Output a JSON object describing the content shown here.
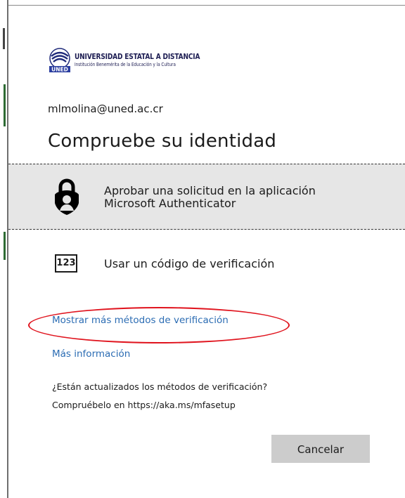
{
  "logo": {
    "title": "UNIVERSIDAD ESTATAL A DISTANCIA",
    "subtitle": "Institución Benemérita de la Educación y la Cultura",
    "seal_text": "UNED"
  },
  "account": {
    "email": "mlmolina@uned.ac.cr"
  },
  "heading": "Compruebe su identidad",
  "options": [
    {
      "label_line1": "Aprobar una solicitud en la aplicación",
      "label_line2": "Microsoft Authenticator",
      "icon": "authenticator-lock-icon",
      "selected": true
    },
    {
      "label": "Usar un código de verificación",
      "badge": "123",
      "icon": "numeric-code-icon"
    }
  ],
  "links": {
    "more_methods": "Mostrar más métodos de verificación",
    "more_info": "Más información"
  },
  "notice": {
    "question": "¿Están actualizados los métodos de verificación?",
    "check": "Compruébelo en https://aka.ms/mfasetup"
  },
  "buttons": {
    "cancel": "Cancelar"
  },
  "colors": {
    "link": "#2b6cb3",
    "highlight_ellipse": "#e0141e",
    "selected_bg": "#e6e6e6",
    "button_bg": "#cccccc"
  }
}
